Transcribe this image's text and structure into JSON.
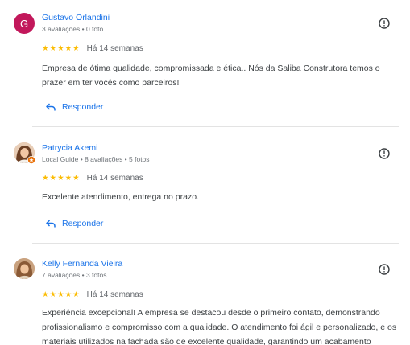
{
  "reviews": [
    {
      "avatar_letter": "G",
      "avatar_color": "#c2185b",
      "name": "Gustavo Orlandini",
      "meta": "3 avaliações • 0 foto",
      "rating": 5,
      "when": "Há 14 semanas",
      "text": "Empresa de ótima qualidade, compromissada e ética.. Nós da Saliba Construtora temos o prazer em ter vocês como parceiros!",
      "reply_label": "Responder"
    },
    {
      "name": "Patrycia Akemi",
      "meta": "Local Guide • 8 avaliações • 5 fotos",
      "rating": 5,
      "when": "Há 14 semanas",
      "text": "Excelente atendimento, entrega no prazo.",
      "reply_label": "Responder"
    },
    {
      "name": "Kelly Fernanda Vieira",
      "meta": "7 avaliações • 3 fotos",
      "rating": 5,
      "when": "Há 14 semanas",
      "text": "Experiência excepcional! A empresa se destacou desde o primeiro contato, demonstrando profissionalismo e compromisso com a qualidade. O atendimento foi ágil e personalizado, e os materiais utilizados na fachada são de excelente qualidade, garantindo um acabamento"
    }
  ],
  "colors": {
    "accent": "#1a73e8",
    "star": "#fbbc04",
    "muted": "#70757a"
  },
  "icons": {
    "flag": "report-icon",
    "reply": "reply-arrow-icon",
    "star": "star-icon"
  }
}
